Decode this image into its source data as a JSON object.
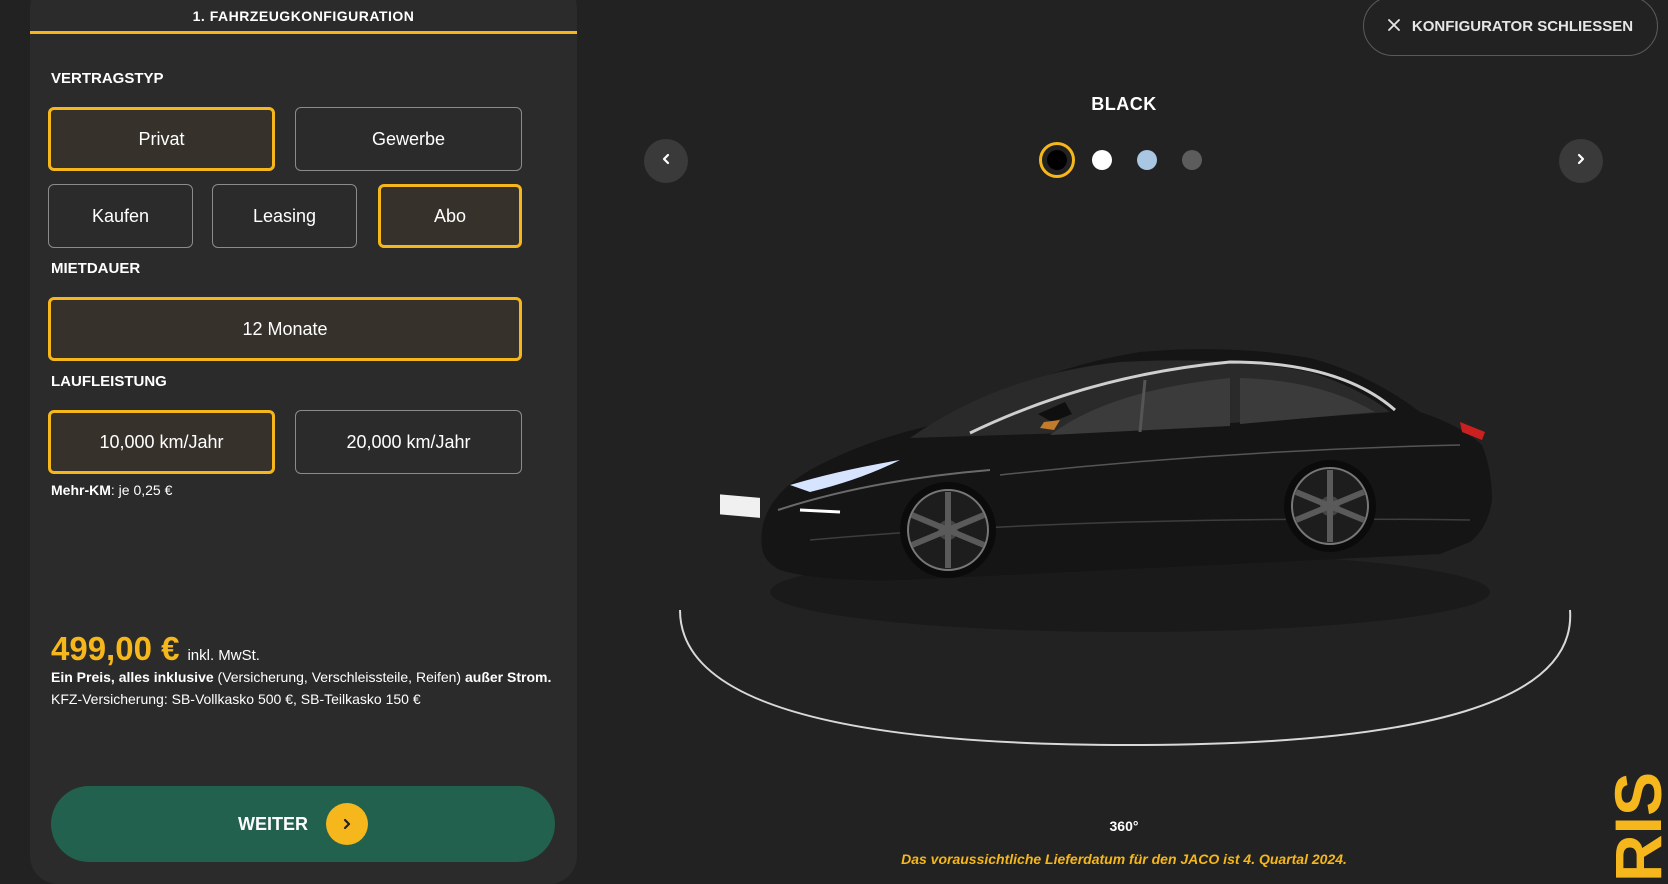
{
  "step_tab": "1. FAHRZEUGKONFIGURATION",
  "vertragstyp": {
    "label": "VERTRAGSTYP",
    "customer_types": [
      {
        "label": "Privat",
        "selected": true
      },
      {
        "label": "Gewerbe",
        "selected": false
      }
    ],
    "purchase_types": [
      {
        "label": "Kaufen",
        "selected": false
      },
      {
        "label": "Leasing",
        "selected": false
      },
      {
        "label": "Abo",
        "selected": true
      }
    ]
  },
  "mietdauer": {
    "label": "MIETDAUER",
    "value": "12 Monate"
  },
  "laufleistung": {
    "label": "LAUFLEISTUNG",
    "options": [
      {
        "label": "10,000 km/Jahr",
        "selected": true
      },
      {
        "label": "20,000 km/Jahr",
        "selected": false
      }
    ],
    "extra_km_label": "Mehr-KM",
    "extra_km_value": ": je 0,25 €"
  },
  "price": {
    "value": "499,00 €",
    "suffix": "inkl. MwSt."
  },
  "description": {
    "bold_start": "Ein Preis, alles inklusive",
    "middle": " (Versicherung, Verschleissteile, Reifen) ",
    "bold_end": "außer Strom.",
    "insurance": "KFZ-Versicherung: SB-Vollkasko 500 €, SB-Teilkasko 150 €"
  },
  "weiter_label": "WEITER",
  "close_label": "KONFIGURATOR SCHLIESSEN",
  "selected_color_name": "BLACK",
  "colors": {
    "accent": "#f5b71b",
    "primary_button": "#22614d",
    "panel_bg": "#2b2b2b",
    "page_bg": "#222222"
  },
  "swatches": [
    "#000000",
    "#ffffff",
    "#a9c7e3",
    "#5c5c5c"
  ],
  "view_label": "360°",
  "delivery_note": "Das voraussichtliche Lieferdatum für den JACO ist 4. Quartal 2024.",
  "brand_fragment": "RIS",
  "icons": {
    "close": "close-icon",
    "prev": "chevron-left-icon",
    "next": "chevron-right-icon",
    "weiter": "chevron-right-icon"
  }
}
